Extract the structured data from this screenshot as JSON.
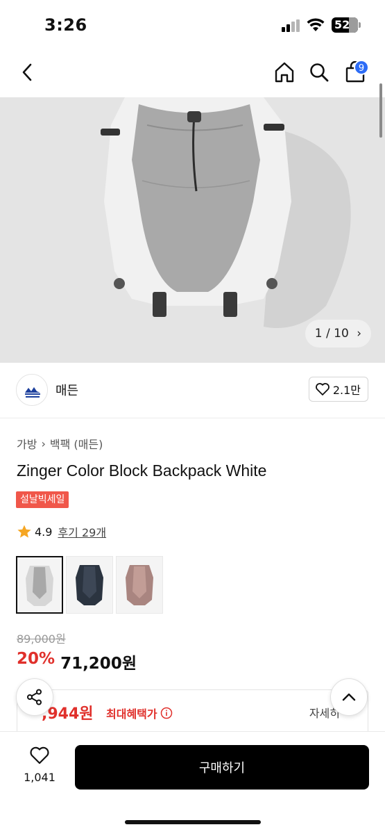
{
  "status": {
    "time": "3:26",
    "battery": "52"
  },
  "nav": {
    "cart_count": "9"
  },
  "gallery": {
    "counter": "1 / 10"
  },
  "brand": {
    "name": "매든",
    "likes": "2.1만"
  },
  "breadcrumb": {
    "category": "가방",
    "subcategory": "백팩 (매든)"
  },
  "product": {
    "title": "Zinger Color Block Backpack White",
    "sale_tag": "설날빅세일",
    "rating": "4.9",
    "reviews": "후기 29개",
    "original_price": "89,000원",
    "discount": "20%",
    "price": "71,200원"
  },
  "benefit": {
    "price": ",944원",
    "label": "최대혜택가",
    "detail": "자세히"
  },
  "bottom": {
    "wish_count": "1,041",
    "buy_label": "구매하기"
  },
  "colors": {
    "accent_red": "#e0302b",
    "badge_blue": "#2d6cf6",
    "sale_tag": "#f0574a"
  }
}
